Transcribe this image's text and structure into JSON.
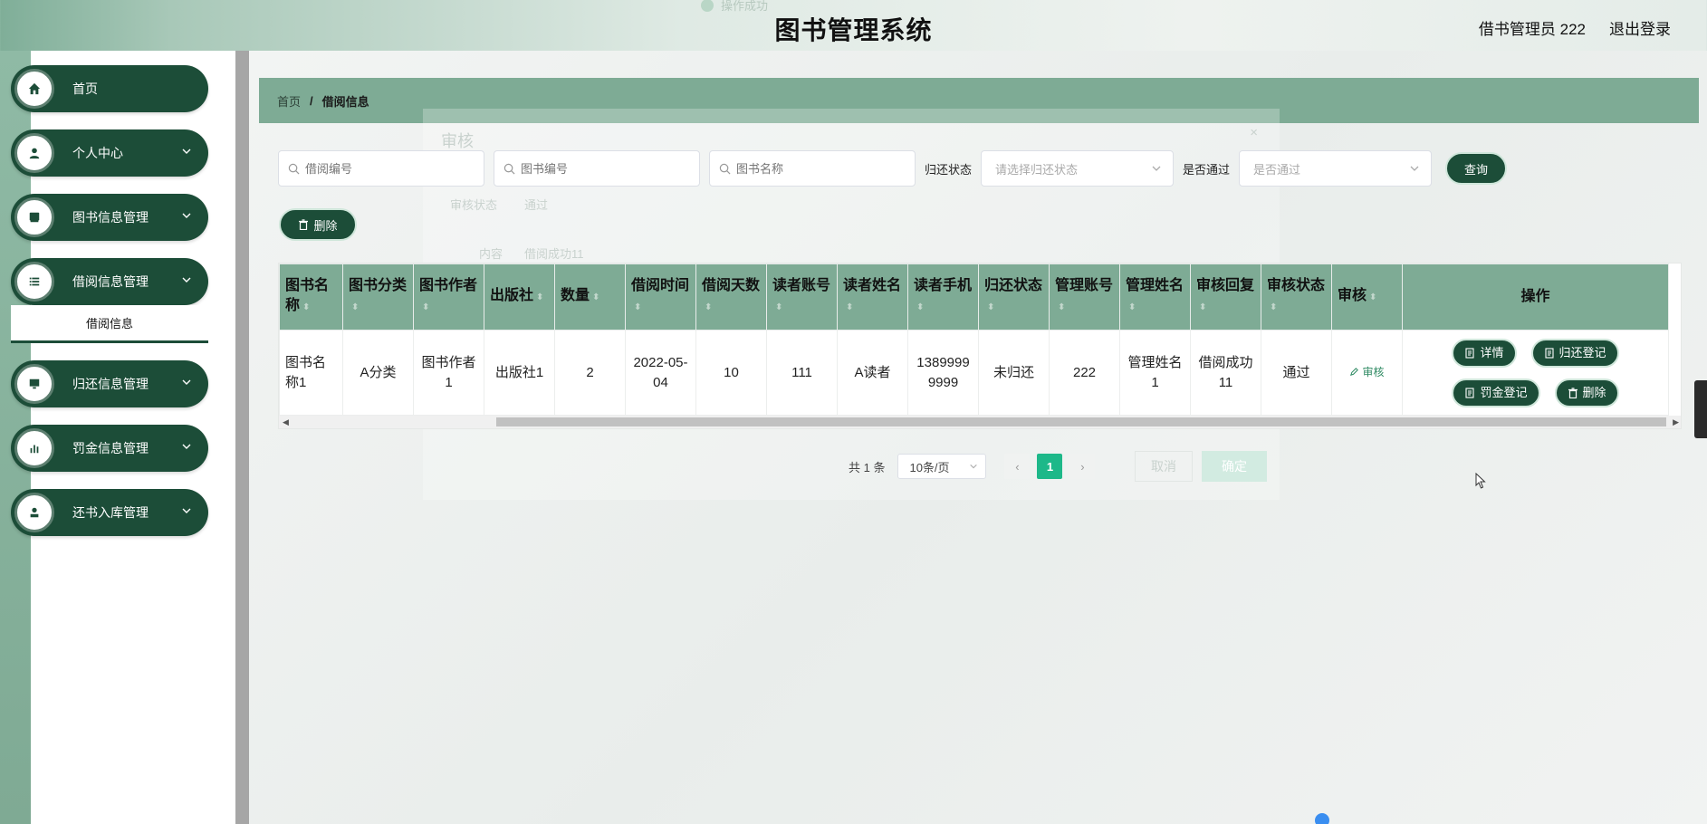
{
  "header": {
    "title": "图书管理系统",
    "ghost_toast": "操作成功",
    "user_label": "借书管理员 222",
    "logout_label": "退出登录"
  },
  "sidebar": {
    "items": [
      {
        "label": "首页",
        "icon": "home-icon",
        "has_children": false
      },
      {
        "label": "个人中心",
        "icon": "user-icon",
        "has_children": true
      },
      {
        "label": "图书信息管理",
        "icon": "book-icon",
        "has_children": true
      },
      {
        "label": "借阅信息管理",
        "icon": "list-icon",
        "has_children": true,
        "expanded": true,
        "children": [
          {
            "label": "借阅信息",
            "active": true
          }
        ]
      },
      {
        "label": "归还信息管理",
        "icon": "monitor-icon",
        "has_children": true
      },
      {
        "label": "罚金信息管理",
        "icon": "bar-chart-icon",
        "has_children": true
      },
      {
        "label": "还书入库管理",
        "icon": "person-icon",
        "has_children": true
      }
    ]
  },
  "breadcrumb": {
    "home": "首页",
    "separator": "/",
    "current": "借阅信息"
  },
  "ghost_dialog": {
    "title": "审核",
    "close": "×",
    "status_label": "审核状态",
    "status_value": "通过",
    "content_label": "内容",
    "content_value": "借阅成功11",
    "cancel": "取消",
    "confirm": "确定"
  },
  "filters": {
    "borrow_no_placeholder": "借阅编号",
    "book_no_placeholder": "图书编号",
    "book_name_placeholder": "图书名称",
    "return_status_label": "归还状态",
    "return_status_placeholder": "请选择归还状态",
    "passed_label": "是否通过",
    "passed_placeholder": "是否通过",
    "search_label": "查询"
  },
  "toolbar": {
    "delete_label": "删除"
  },
  "table": {
    "headers": [
      "图书名称",
      "图书分类",
      "图书作者",
      "出版社",
      "数量",
      "借阅时间",
      "借阅天数",
      "读者账号",
      "读者姓名",
      "读者手机",
      "归还状态",
      "管理账号",
      "管理姓名",
      "审核回复",
      "审核状态",
      "审核",
      "操作"
    ],
    "rows": [
      {
        "cells": [
          "图书名称1",
          "A分类",
          "图书作者1",
          "出版社1",
          "2",
          "2022-05-04",
          "10",
          "111",
          "A读者",
          "13899999999",
          "未归还",
          "222",
          "管理姓名1",
          "借阅成功11",
          "通过"
        ],
        "audit_link": "审核",
        "actions": [
          "详情",
          "归还登记",
          "罚金登记",
          "删除"
        ]
      }
    ]
  },
  "pagination": {
    "total": "共 1 条",
    "page_size": "10条/页",
    "current_page": "1"
  },
  "colors": {
    "primary": "#1c4d38",
    "header_bg": "#7eab95",
    "page_active": "#1db889"
  }
}
